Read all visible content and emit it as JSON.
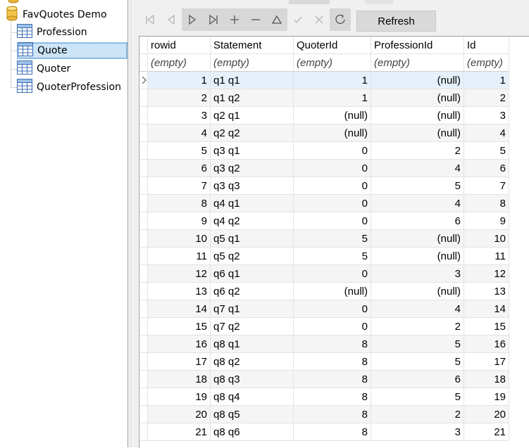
{
  "tree": {
    "root_label": "FavQuotes Demo",
    "tables": [
      "Profession",
      "Quote",
      "Quoter",
      "QuoterProfession"
    ],
    "selected": "Quote"
  },
  "toolbar": {
    "buttons": [
      "first-icon",
      "prior-icon",
      "next-icon",
      "last-icon",
      "insert-icon",
      "delete-icon",
      "edit-icon",
      "post-icon",
      "cancel-icon",
      "refresh-circle-icon"
    ],
    "refresh_label": "Refresh"
  },
  "grid": {
    "columns": [
      "rowid",
      "Statement",
      "QuoterId",
      "ProfessionId",
      "Id"
    ],
    "filter_placeholder": "(empty)",
    "rows": [
      [
        "1",
        "q1 q1",
        "1",
        "(null)",
        "1"
      ],
      [
        "2",
        "q1 q2",
        "1",
        "(null)",
        "2"
      ],
      [
        "3",
        "q2 q1",
        "(null)",
        "(null)",
        "3"
      ],
      [
        "4",
        "q2 q2",
        "(null)",
        "(null)",
        "4"
      ],
      [
        "5",
        "q3 q1",
        "0",
        "2",
        "5"
      ],
      [
        "6",
        "q3 q2",
        "0",
        "4",
        "6"
      ],
      [
        "7",
        "q3 q3",
        "0",
        "5",
        "7"
      ],
      [
        "8",
        "q4 q1",
        "0",
        "4",
        "8"
      ],
      [
        "9",
        "q4 q2",
        "0",
        "6",
        "9"
      ],
      [
        "10",
        "q5 q1",
        "5",
        "(null)",
        "10"
      ],
      [
        "11",
        "q5 q2",
        "5",
        "(null)",
        "11"
      ],
      [
        "12",
        "q6 q1",
        "0",
        "3",
        "12"
      ],
      [
        "13",
        "q6 q2",
        "(null)",
        "(null)",
        "13"
      ],
      [
        "14",
        "q7 q1",
        "0",
        "4",
        "14"
      ],
      [
        "15",
        "q7 q2",
        "0",
        "2",
        "15"
      ],
      [
        "16",
        "q8 q1",
        "8",
        "5",
        "16"
      ],
      [
        "17",
        "q8 q2",
        "8",
        "5",
        "17"
      ],
      [
        "18",
        "q8 q3",
        "8",
        "6",
        "18"
      ],
      [
        "19",
        "q8 q4",
        "8",
        "5",
        "19"
      ],
      [
        "20",
        "q8 q5",
        "8",
        "2",
        "20"
      ],
      [
        "21",
        "q8 q6",
        "8",
        "3",
        "21"
      ]
    ]
  },
  "colors": {
    "selection": "#cce4f7",
    "current_row": "#e5f0fb",
    "alt_row": "#f5f5f5",
    "grid_line": "#e3e3e3"
  }
}
